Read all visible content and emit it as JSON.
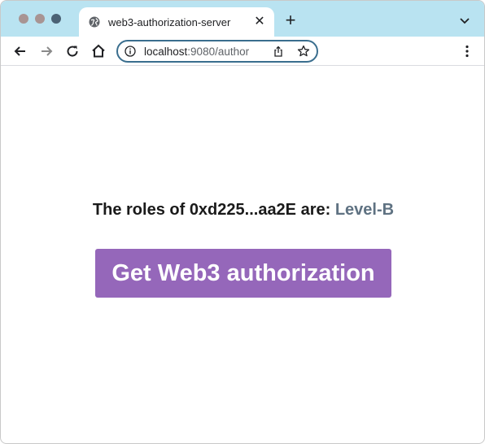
{
  "browser": {
    "tab": {
      "title": "web3-authorization-server",
      "favicon": "globe-icon"
    },
    "omnibox": {
      "url_host": "localhost",
      "url_rest": ":9080/author"
    },
    "colors": {
      "tabstrip": "#b9e3f1",
      "omnibox_border": "#3a6e8e"
    }
  },
  "page": {
    "roles_prefix": "The roles of 0xd225...aa2E are:",
    "roles_value": "Level-B",
    "auth_button_label": "Get Web3 authorization",
    "colors": {
      "button": "#9567ba",
      "role_value": "#5f7282"
    }
  }
}
